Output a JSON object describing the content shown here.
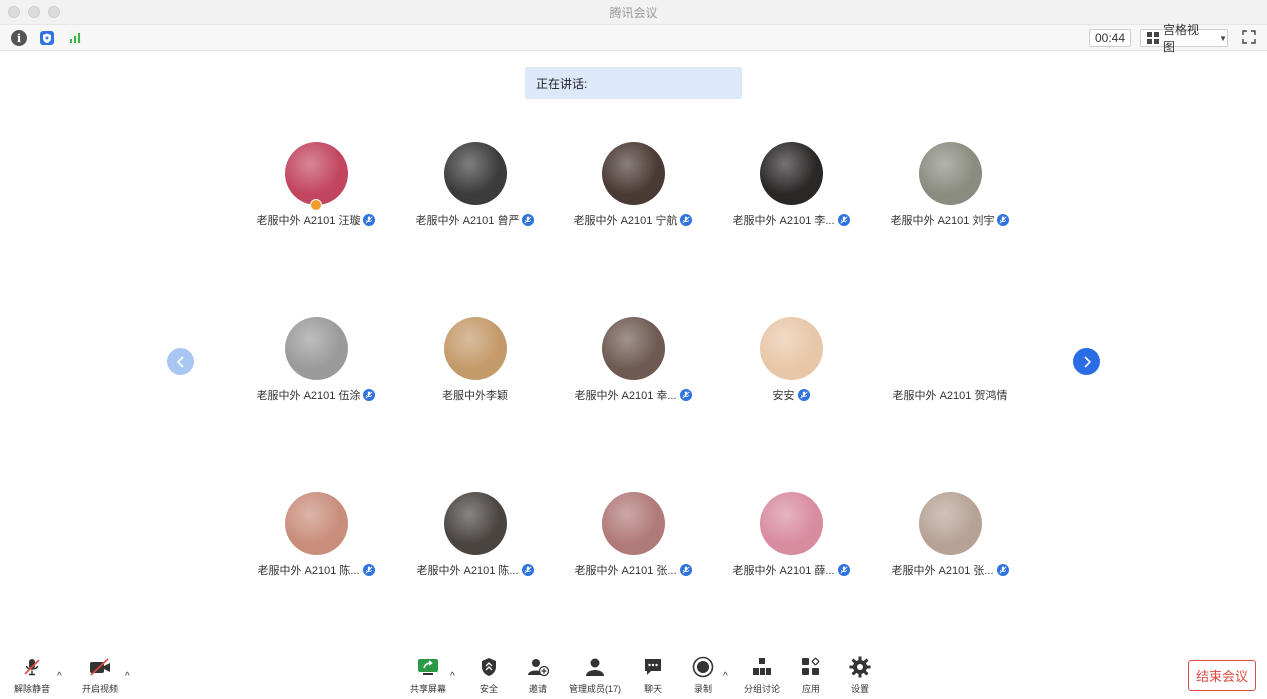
{
  "window": {
    "title": "腾讯会议"
  },
  "toolbar": {
    "info_icon": "info-icon",
    "security_icon": "shield-icon",
    "network_icon": "signal-icon",
    "timer": "00:44",
    "view_label": "宫格视图",
    "fullscreen_icon": "fullscreen-icon"
  },
  "speaking": {
    "label": "正在讲话:"
  },
  "participants": [
    {
      "name": "老服中外 A2101 汪璇",
      "muted": true,
      "host": true,
      "color": "#c2455f"
    },
    {
      "name": "老服中外 A2101 曾严",
      "muted": true,
      "host": false,
      "color": "#3b3b3b"
    },
    {
      "name": "老服中外 A2101 宁航",
      "muted": true,
      "host": false,
      "color": "#4a3a34"
    },
    {
      "name": "老服中外 A2101 李...",
      "muted": true,
      "host": false,
      "color": "#2a2727"
    },
    {
      "name": "老服中外 A2101 刘宇",
      "muted": true,
      "host": false,
      "color": "#8a8c80"
    },
    {
      "name": "老服中外 A2101 伍涂",
      "muted": true,
      "host": false,
      "color": "#9a9a9a"
    },
    {
      "name": "老服中外李颖",
      "muted": false,
      "host": false,
      "color": "#c49a6a"
    },
    {
      "name": "老服中外 A2101 幸...",
      "muted": true,
      "host": false,
      "color": "#6e5a52"
    },
    {
      "name": "安安",
      "muted": true,
      "host": false,
      "color": "#e8c7a8"
    },
    {
      "name": "老服中外 A2101 贺鸿情",
      "muted": false,
      "host": false,
      "color": ""
    },
    {
      "name": "老服中外 A2101 陈...",
      "muted": true,
      "host": false,
      "color": "#c98d7c"
    },
    {
      "name": "老服中外 A2101 陈...",
      "muted": true,
      "host": false,
      "color": "#4a4440"
    },
    {
      "name": "老服中外 A2101 张...",
      "muted": true,
      "host": false,
      "color": "#b07a78"
    },
    {
      "name": "老服中外 A2101 薛...",
      "muted": true,
      "host": false,
      "color": "#d88ca0"
    },
    {
      "name": "老服中外 A2101 张...",
      "muted": true,
      "host": false,
      "color": "#b7a396"
    }
  ],
  "bottom": {
    "unmute": "解除静音",
    "video": "开启视频",
    "share": "共享屏幕",
    "security": "安全",
    "invite": "邀请",
    "members": "管理成员(17)",
    "chat": "聊天",
    "record": "录制",
    "breakout": "分组讨论",
    "apps": "应用",
    "settings": "设置",
    "end": "结束会议"
  },
  "colors": {
    "accent": "#2a6ce4",
    "end_red": "#e04a40",
    "speaking_bg": "#dde9fb"
  }
}
